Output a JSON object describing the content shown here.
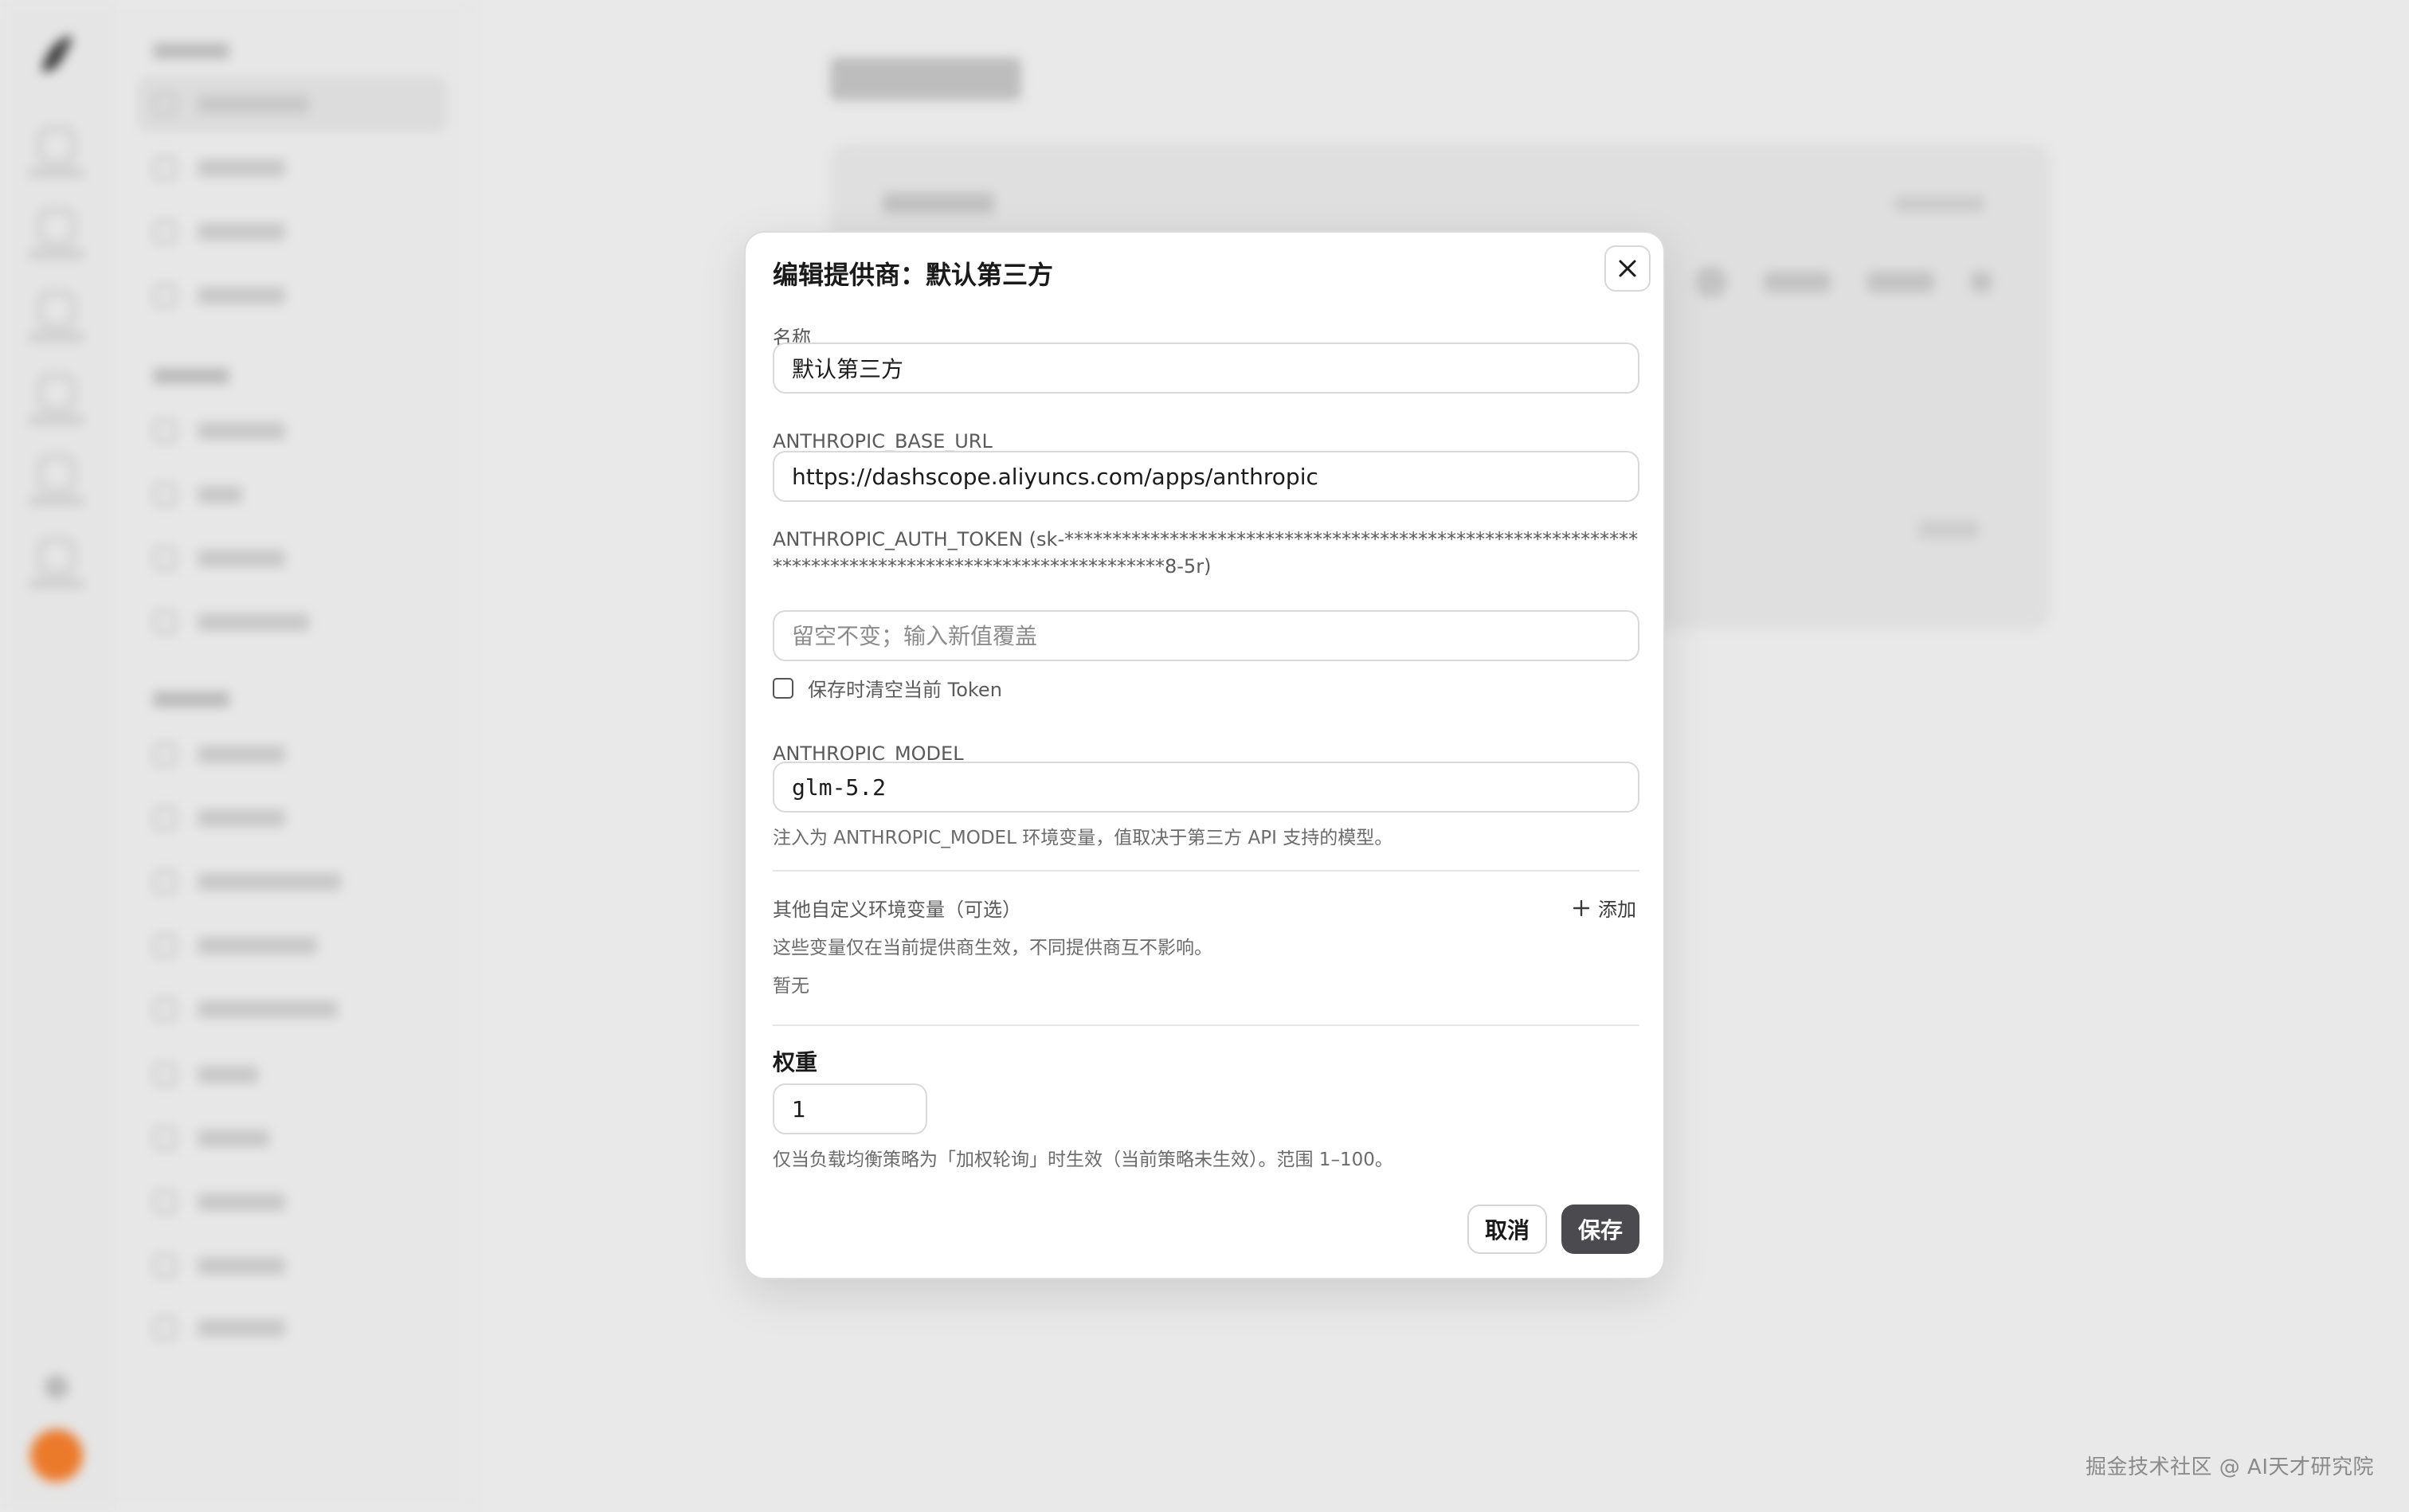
{
  "modal": {
    "title": "编辑提供商：默认第三方",
    "name_label": "名称",
    "name_value": "默认第三方",
    "base_url_label": "ANTHROPIC_BASE_URL",
    "base_url_value": "https://dashscope.aliyuncs.com/apps/anthropic",
    "token_label": "ANTHROPIC_AUTH_TOKEN (sk-*****************************************************************************************************8-5r)",
    "token_placeholder": "留空不变；输入新值覆盖",
    "clear_token_label": "保存时清空当前 Token",
    "model_label": "ANTHROPIC_MODEL",
    "model_value": "glm-5.2",
    "model_hint": "注入为 ANTHROPIC_MODEL 环境变量，值取决于第三方 API 支持的模型。",
    "custom_env_title": "其他自定义环境变量（可选）",
    "add_label": "添加",
    "custom_env_hint": "这些变量仅在当前提供商生效，不同提供商互不影响。",
    "custom_env_empty": "暂无",
    "weight_title": "权重",
    "weight_value": "1",
    "weight_hint": "仅当负载均衡策略为「加权轮询」时生效（当前策略未生效）。范围 1–100。",
    "cancel_label": "取消",
    "save_label": "保存"
  },
  "watermark": "掘金技术社区 @ AI天才研究院",
  "icons": {
    "close": "close-icon",
    "add": "plus-icon",
    "checkbox": "checkbox-unchecked"
  },
  "colors": {
    "save_button": "#4a4a4f",
    "avatar": "#ec7a2b"
  }
}
